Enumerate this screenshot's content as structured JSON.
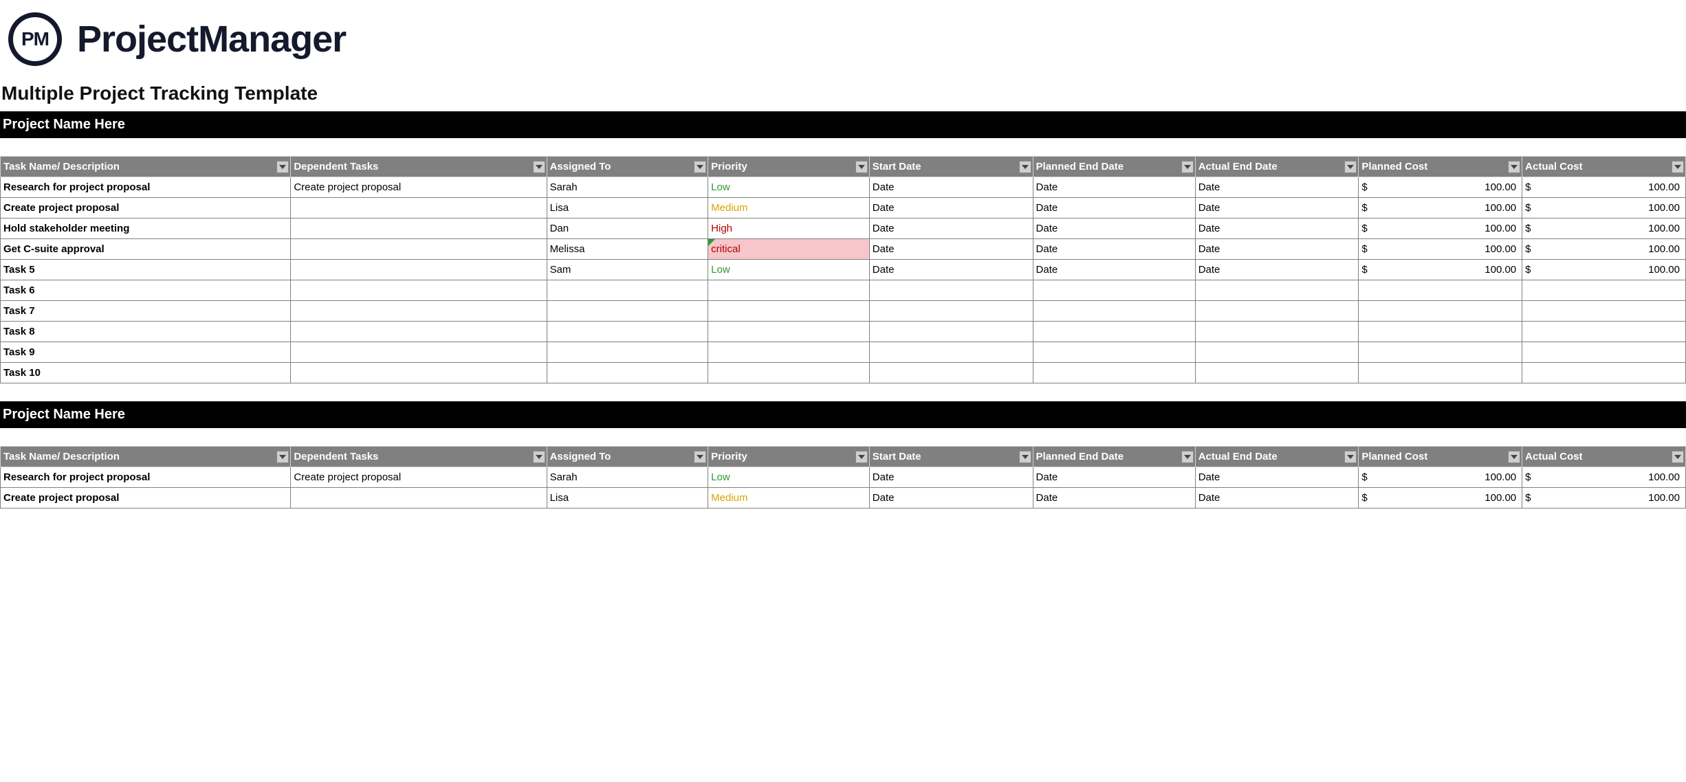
{
  "brand": {
    "logo_text": "PM",
    "name": "ProjectManager"
  },
  "page_title": "Multiple Project Tracking Template",
  "columns": {
    "task": "Task Name/ Description",
    "dep": "Dependent Tasks",
    "assigned": "Assigned To",
    "priority": "Priority",
    "start": "Start Date",
    "planned_end": "Planned End Date",
    "actual_end": "Actual End Date",
    "planned_cost": "Planned Cost",
    "actual_cost": "Actual Cost"
  },
  "currency_symbol": "$",
  "projects": [
    {
      "title": "Project Name Here",
      "rows": [
        {
          "task": "Research for project proposal",
          "dep": "Create project proposal",
          "assigned": "Sarah",
          "priority": "Low",
          "start": "Date",
          "planned_end": "Date",
          "actual_end": "Date",
          "planned_cost": "100.00",
          "actual_cost": "100.00"
        },
        {
          "task": "Create project proposal",
          "dep": "",
          "assigned": "Lisa",
          "priority": "Medium",
          "start": "Date",
          "planned_end": "Date",
          "actual_end": "Date",
          "planned_cost": "100.00",
          "actual_cost": "100.00"
        },
        {
          "task": "Hold stakeholder meeting",
          "dep": "",
          "assigned": "Dan",
          "priority": "High",
          "start": "Date",
          "planned_end": "Date",
          "actual_end": "Date",
          "planned_cost": "100.00",
          "actual_cost": "100.00"
        },
        {
          "task": "Get C-suite approval",
          "dep": "",
          "assigned": "Melissa",
          "priority": "critical",
          "start": "Date",
          "planned_end": "Date",
          "actual_end": "Date",
          "planned_cost": "100.00",
          "actual_cost": "100.00"
        },
        {
          "task": "Task 5",
          "dep": "",
          "assigned": "Sam",
          "priority": "Low",
          "start": "Date",
          "planned_end": "Date",
          "actual_end": "Date",
          "planned_cost": "100.00",
          "actual_cost": "100.00"
        },
        {
          "task": "Task 6",
          "dep": "",
          "assigned": "",
          "priority": "",
          "start": "",
          "planned_end": "",
          "actual_end": "",
          "planned_cost": "",
          "actual_cost": ""
        },
        {
          "task": "Task 7",
          "dep": "",
          "assigned": "",
          "priority": "",
          "start": "",
          "planned_end": "",
          "actual_end": "",
          "planned_cost": "",
          "actual_cost": ""
        },
        {
          "task": "Task 8",
          "dep": "",
          "assigned": "",
          "priority": "",
          "start": "",
          "planned_end": "",
          "actual_end": "",
          "planned_cost": "",
          "actual_cost": ""
        },
        {
          "task": "Task 9",
          "dep": "",
          "assigned": "",
          "priority": "",
          "start": "",
          "planned_end": "",
          "actual_end": "",
          "planned_cost": "",
          "actual_cost": ""
        },
        {
          "task": "Task 10",
          "dep": "",
          "assigned": "",
          "priority": "",
          "start": "",
          "planned_end": "",
          "actual_end": "",
          "planned_cost": "",
          "actual_cost": ""
        }
      ]
    },
    {
      "title": "Project Name Here",
      "rows": [
        {
          "task": "Research for project proposal",
          "dep": "Create project proposal",
          "assigned": "Sarah",
          "priority": "Low",
          "start": "Date",
          "planned_end": "Date",
          "actual_end": "Date",
          "planned_cost": "100.00",
          "actual_cost": "100.00"
        },
        {
          "task": "Create project proposal",
          "dep": "",
          "assigned": "Lisa",
          "priority": "Medium",
          "start": "Date",
          "planned_end": "Date",
          "actual_end": "Date",
          "planned_cost": "100.00",
          "actual_cost": "100.00"
        }
      ]
    }
  ]
}
